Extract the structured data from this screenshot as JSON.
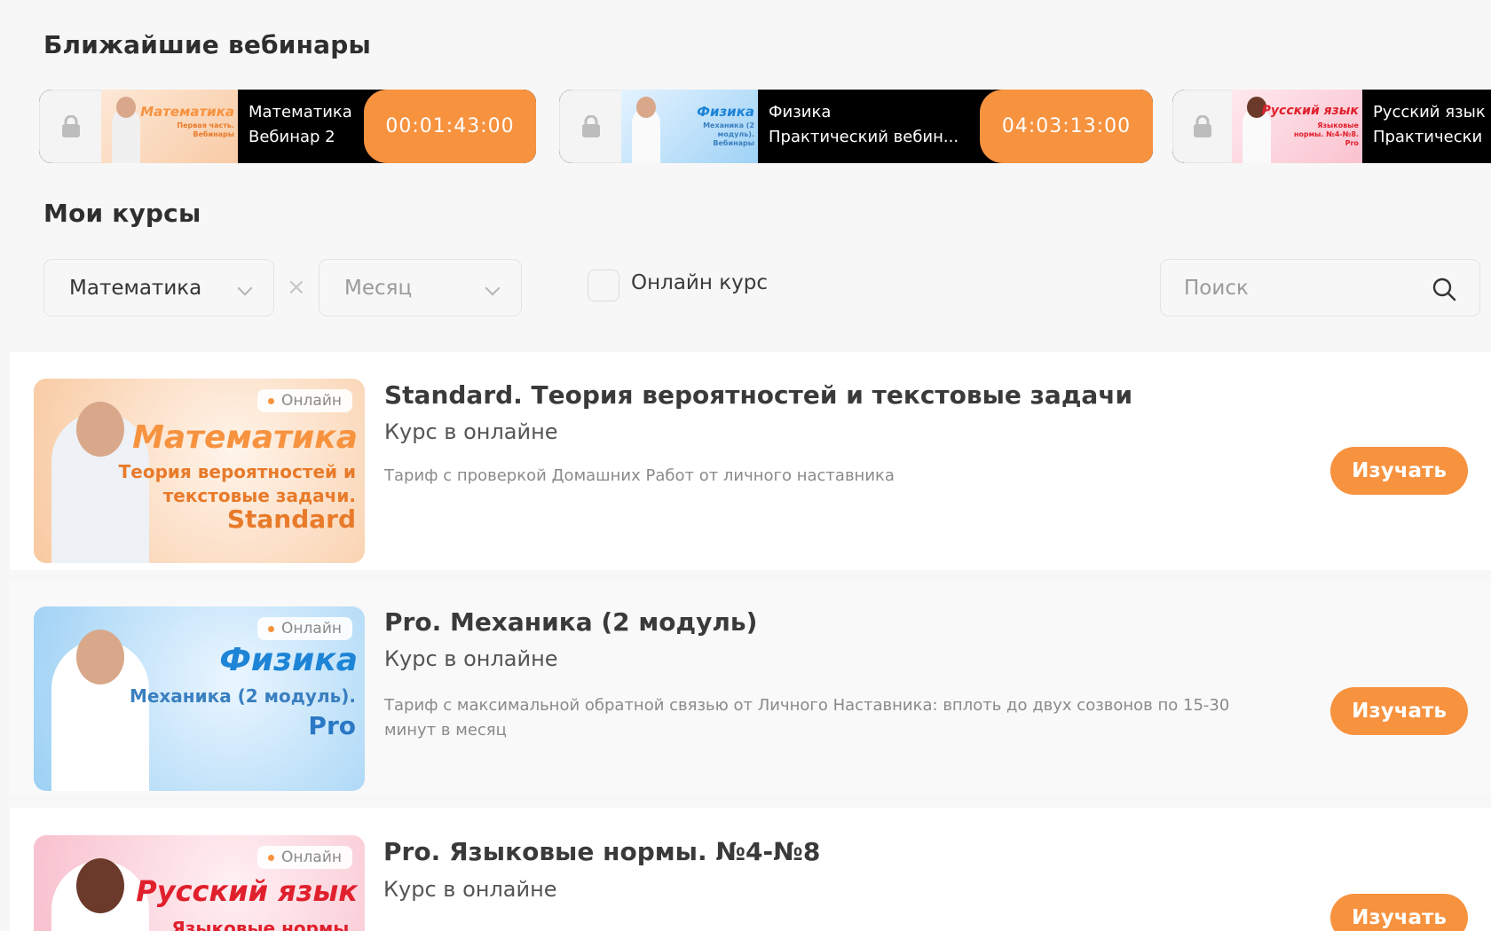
{
  "webinars": {
    "title": "Ближайшие вебинары",
    "items": [
      {
        "thumb_title": "Математика",
        "thumb_sub": "Первая часть. Вебинары",
        "line1": "Математика",
        "line2": "Вебинар 2",
        "timer": "00:01:43:00"
      },
      {
        "thumb_title": "Физика",
        "thumb_sub": "Механика (2 модуль). Вебинары",
        "line1": "Физика",
        "line2": "Практический вебин...",
        "timer": "04:03:13:00"
      },
      {
        "thumb_title": "Русский язык",
        "thumb_sub": "Языковые нормы. №4-№8. Pro",
        "line1": "Русский язык",
        "line2": "Практически"
      }
    ]
  },
  "courses": {
    "title": "Мои курсы",
    "filters": {
      "subject": "Математика",
      "month_placeholder": "Месяц",
      "clear": "×",
      "online_label": "Онлайн курс",
      "search_placeholder": "Поиск"
    },
    "items": [
      {
        "badge": "Онлайн",
        "thumb_title": "Математика",
        "thumb_sub": "Теория вероятностей и текстовые задачи.",
        "thumb_tier": "Standard",
        "name": "Standard. Теория вероятностей и текстовые задачи",
        "type": "Курс в онлайне",
        "description": "Тариф с проверкой Домашних Работ от личного наставника",
        "button": "Изучать"
      },
      {
        "badge": "Онлайн",
        "thumb_title": "Физика",
        "thumb_sub": "Механика (2 модуль).",
        "thumb_tier": "Pro",
        "name": "Pro. Механика (2 модуль)",
        "type": "Курс в онлайне",
        "description": "Тариф с максимальной обратной связью от Личного Наставника: вплоть до двух созвонов по 15-30 минут в месяц",
        "button": "Изучать"
      },
      {
        "badge": "Онлайн",
        "thumb_title": "Русский язык",
        "thumb_sub": "Языковые нормы.",
        "name": "Pro. Языковые нормы. №4-№8",
        "type": "Курс в онлайне",
        "button": "Изучать"
      }
    ]
  },
  "colors": {
    "accent": "#f7923f",
    "background": "#f7f7f7",
    "math_title": "#f7923f",
    "physics_title": "#1d84d6",
    "russian_title": "#e0202c"
  }
}
